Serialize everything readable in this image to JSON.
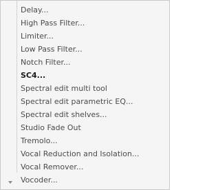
{
  "menu": {
    "items": [
      {
        "label": "Delay...",
        "emph": false
      },
      {
        "label": "High Pass Filter...",
        "emph": false
      },
      {
        "label": "Limiter...",
        "emph": false
      },
      {
        "label": "Low Pass Filter...",
        "emph": false
      },
      {
        "label": "Notch Filter...",
        "emph": false
      },
      {
        "label": "SC4...",
        "emph": true
      },
      {
        "label": "Spectral edit multi tool",
        "emph": false
      },
      {
        "label": "Spectral edit parametric EQ...",
        "emph": false
      },
      {
        "label": "Spectral edit shelves...",
        "emph": false
      },
      {
        "label": "Studio Fade Out",
        "emph": false
      },
      {
        "label": "Tremolo...",
        "emph": false
      },
      {
        "label": "Vocal Reduction and Isolation...",
        "emph": false
      },
      {
        "label": "Vocal Remover...",
        "emph": false
      },
      {
        "label": "Vocoder...",
        "emph": false
      }
    ],
    "scroll_indicator": "chevron-down-icon"
  }
}
